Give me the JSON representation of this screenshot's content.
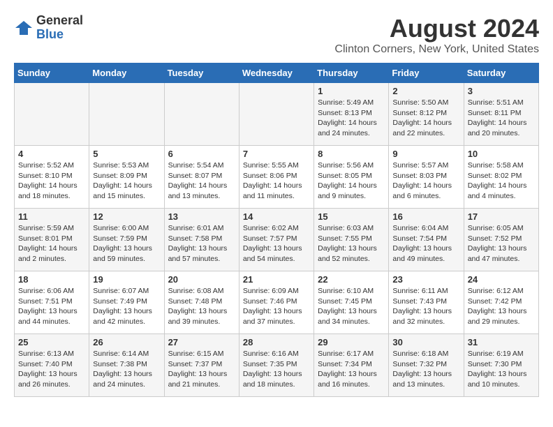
{
  "logo": {
    "general": "General",
    "blue": "Blue"
  },
  "header": {
    "title": "August 2024",
    "subtitle": "Clinton Corners, New York, United States"
  },
  "days_of_week": [
    "Sunday",
    "Monday",
    "Tuesday",
    "Wednesday",
    "Thursday",
    "Friday",
    "Saturday"
  ],
  "weeks": [
    [
      {
        "day": "",
        "info": ""
      },
      {
        "day": "",
        "info": ""
      },
      {
        "day": "",
        "info": ""
      },
      {
        "day": "",
        "info": ""
      },
      {
        "day": "1",
        "info": "Sunrise: 5:49 AM\nSunset: 8:13 PM\nDaylight: 14 hours\nand 24 minutes."
      },
      {
        "day": "2",
        "info": "Sunrise: 5:50 AM\nSunset: 8:12 PM\nDaylight: 14 hours\nand 22 minutes."
      },
      {
        "day": "3",
        "info": "Sunrise: 5:51 AM\nSunset: 8:11 PM\nDaylight: 14 hours\nand 20 minutes."
      }
    ],
    [
      {
        "day": "4",
        "info": "Sunrise: 5:52 AM\nSunset: 8:10 PM\nDaylight: 14 hours\nand 18 minutes."
      },
      {
        "day": "5",
        "info": "Sunrise: 5:53 AM\nSunset: 8:09 PM\nDaylight: 14 hours\nand 15 minutes."
      },
      {
        "day": "6",
        "info": "Sunrise: 5:54 AM\nSunset: 8:07 PM\nDaylight: 14 hours\nand 13 minutes."
      },
      {
        "day": "7",
        "info": "Sunrise: 5:55 AM\nSunset: 8:06 PM\nDaylight: 14 hours\nand 11 minutes."
      },
      {
        "day": "8",
        "info": "Sunrise: 5:56 AM\nSunset: 8:05 PM\nDaylight: 14 hours\nand 9 minutes."
      },
      {
        "day": "9",
        "info": "Sunrise: 5:57 AM\nSunset: 8:03 PM\nDaylight: 14 hours\nand 6 minutes."
      },
      {
        "day": "10",
        "info": "Sunrise: 5:58 AM\nSunset: 8:02 PM\nDaylight: 14 hours\nand 4 minutes."
      }
    ],
    [
      {
        "day": "11",
        "info": "Sunrise: 5:59 AM\nSunset: 8:01 PM\nDaylight: 14 hours\nand 2 minutes."
      },
      {
        "day": "12",
        "info": "Sunrise: 6:00 AM\nSunset: 7:59 PM\nDaylight: 13 hours\nand 59 minutes."
      },
      {
        "day": "13",
        "info": "Sunrise: 6:01 AM\nSunset: 7:58 PM\nDaylight: 13 hours\nand 57 minutes."
      },
      {
        "day": "14",
        "info": "Sunrise: 6:02 AM\nSunset: 7:57 PM\nDaylight: 13 hours\nand 54 minutes."
      },
      {
        "day": "15",
        "info": "Sunrise: 6:03 AM\nSunset: 7:55 PM\nDaylight: 13 hours\nand 52 minutes."
      },
      {
        "day": "16",
        "info": "Sunrise: 6:04 AM\nSunset: 7:54 PM\nDaylight: 13 hours\nand 49 minutes."
      },
      {
        "day": "17",
        "info": "Sunrise: 6:05 AM\nSunset: 7:52 PM\nDaylight: 13 hours\nand 47 minutes."
      }
    ],
    [
      {
        "day": "18",
        "info": "Sunrise: 6:06 AM\nSunset: 7:51 PM\nDaylight: 13 hours\nand 44 minutes."
      },
      {
        "day": "19",
        "info": "Sunrise: 6:07 AM\nSunset: 7:49 PM\nDaylight: 13 hours\nand 42 minutes."
      },
      {
        "day": "20",
        "info": "Sunrise: 6:08 AM\nSunset: 7:48 PM\nDaylight: 13 hours\nand 39 minutes."
      },
      {
        "day": "21",
        "info": "Sunrise: 6:09 AM\nSunset: 7:46 PM\nDaylight: 13 hours\nand 37 minutes."
      },
      {
        "day": "22",
        "info": "Sunrise: 6:10 AM\nSunset: 7:45 PM\nDaylight: 13 hours\nand 34 minutes."
      },
      {
        "day": "23",
        "info": "Sunrise: 6:11 AM\nSunset: 7:43 PM\nDaylight: 13 hours\nand 32 minutes."
      },
      {
        "day": "24",
        "info": "Sunrise: 6:12 AM\nSunset: 7:42 PM\nDaylight: 13 hours\nand 29 minutes."
      }
    ],
    [
      {
        "day": "25",
        "info": "Sunrise: 6:13 AM\nSunset: 7:40 PM\nDaylight: 13 hours\nand 26 minutes."
      },
      {
        "day": "26",
        "info": "Sunrise: 6:14 AM\nSunset: 7:38 PM\nDaylight: 13 hours\nand 24 minutes."
      },
      {
        "day": "27",
        "info": "Sunrise: 6:15 AM\nSunset: 7:37 PM\nDaylight: 13 hours\nand 21 minutes."
      },
      {
        "day": "28",
        "info": "Sunrise: 6:16 AM\nSunset: 7:35 PM\nDaylight: 13 hours\nand 18 minutes."
      },
      {
        "day": "29",
        "info": "Sunrise: 6:17 AM\nSunset: 7:34 PM\nDaylight: 13 hours\nand 16 minutes."
      },
      {
        "day": "30",
        "info": "Sunrise: 6:18 AM\nSunset: 7:32 PM\nDaylight: 13 hours\nand 13 minutes."
      },
      {
        "day": "31",
        "info": "Sunrise: 6:19 AM\nSunset: 7:30 PM\nDaylight: 13 hours\nand 10 minutes."
      }
    ]
  ]
}
